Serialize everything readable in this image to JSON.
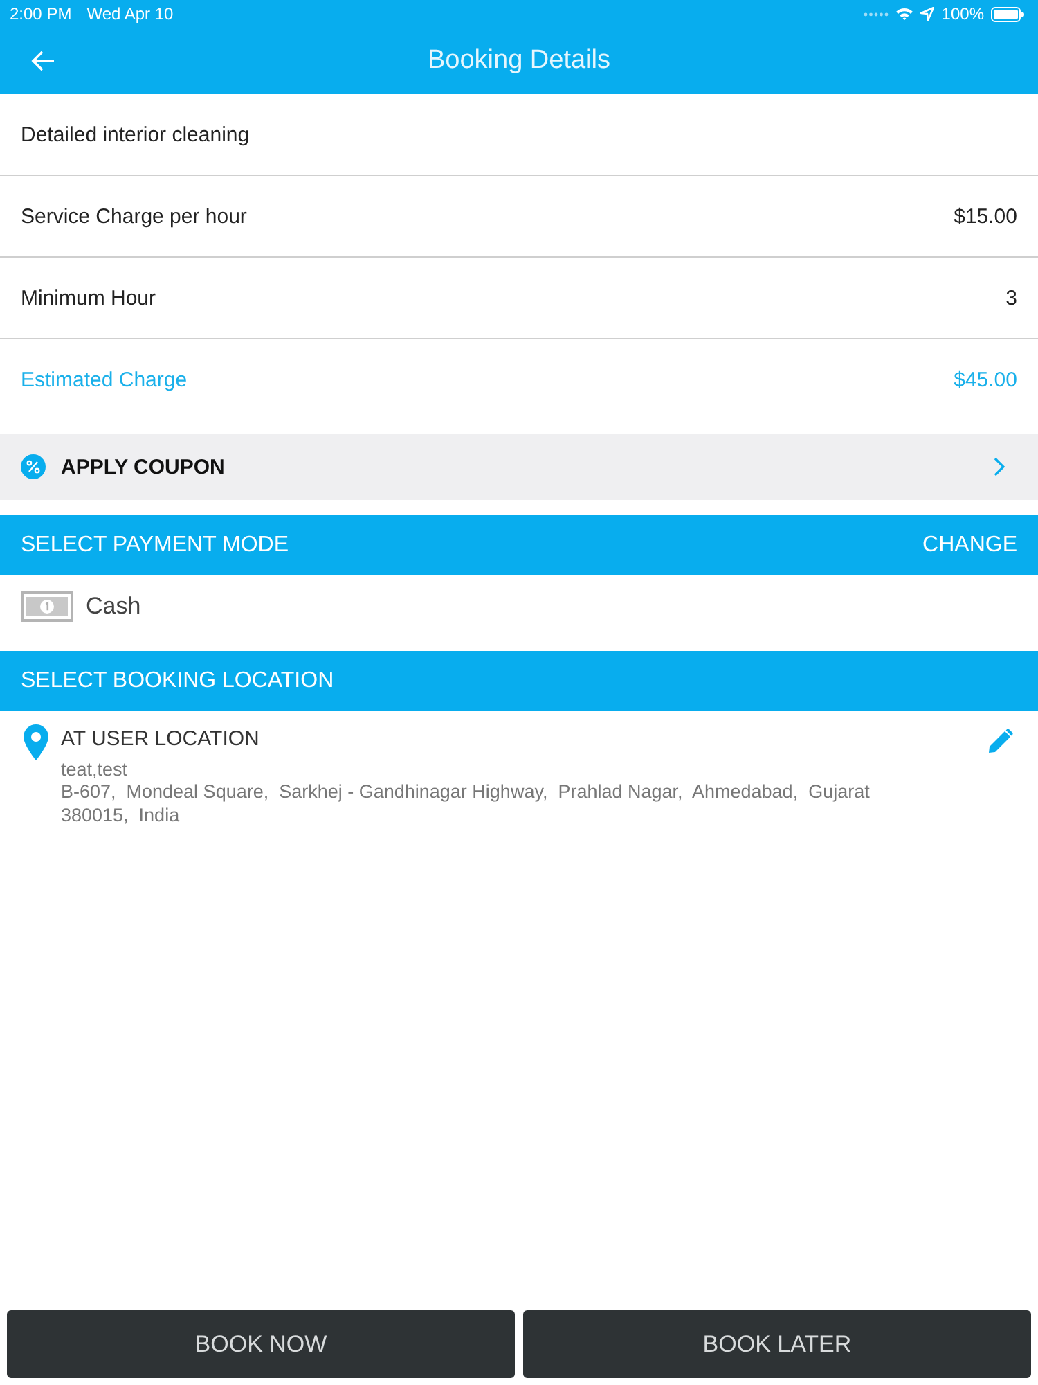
{
  "status_bar": {
    "time": "2:00 PM",
    "date": "Wed Apr 10",
    "battery": "100%"
  },
  "nav_bar": {
    "title": "Booking Details"
  },
  "service": {
    "name": "Detailed interior cleaning"
  },
  "details": [
    {
      "label": "Service Charge per hour",
      "value": "$15.00",
      "kind": "plain"
    },
    {
      "label": "Minimum Hour",
      "value": "3",
      "kind": "plain"
    },
    {
      "label": "Estimated Charge",
      "value": "$45.00",
      "kind": "highlight"
    }
  ],
  "coupon": {
    "label": "APPLY COUPON"
  },
  "payment": {
    "header": "SELECT PAYMENT MODE",
    "action": "CHANGE",
    "method": "Cash"
  },
  "location": {
    "header": "SELECT BOOKING LOCATION",
    "type": "AT USER LOCATION",
    "name": "teat,test",
    "address": "B-607,  Mondeal Square,  Sarkhej - Gandhinagar Highway,  Prahlad Nagar,  Ahmedabad,  Gujarat 380015,  India"
  },
  "actions": [
    "BOOK NOW",
    "BOOK LATER"
  ]
}
